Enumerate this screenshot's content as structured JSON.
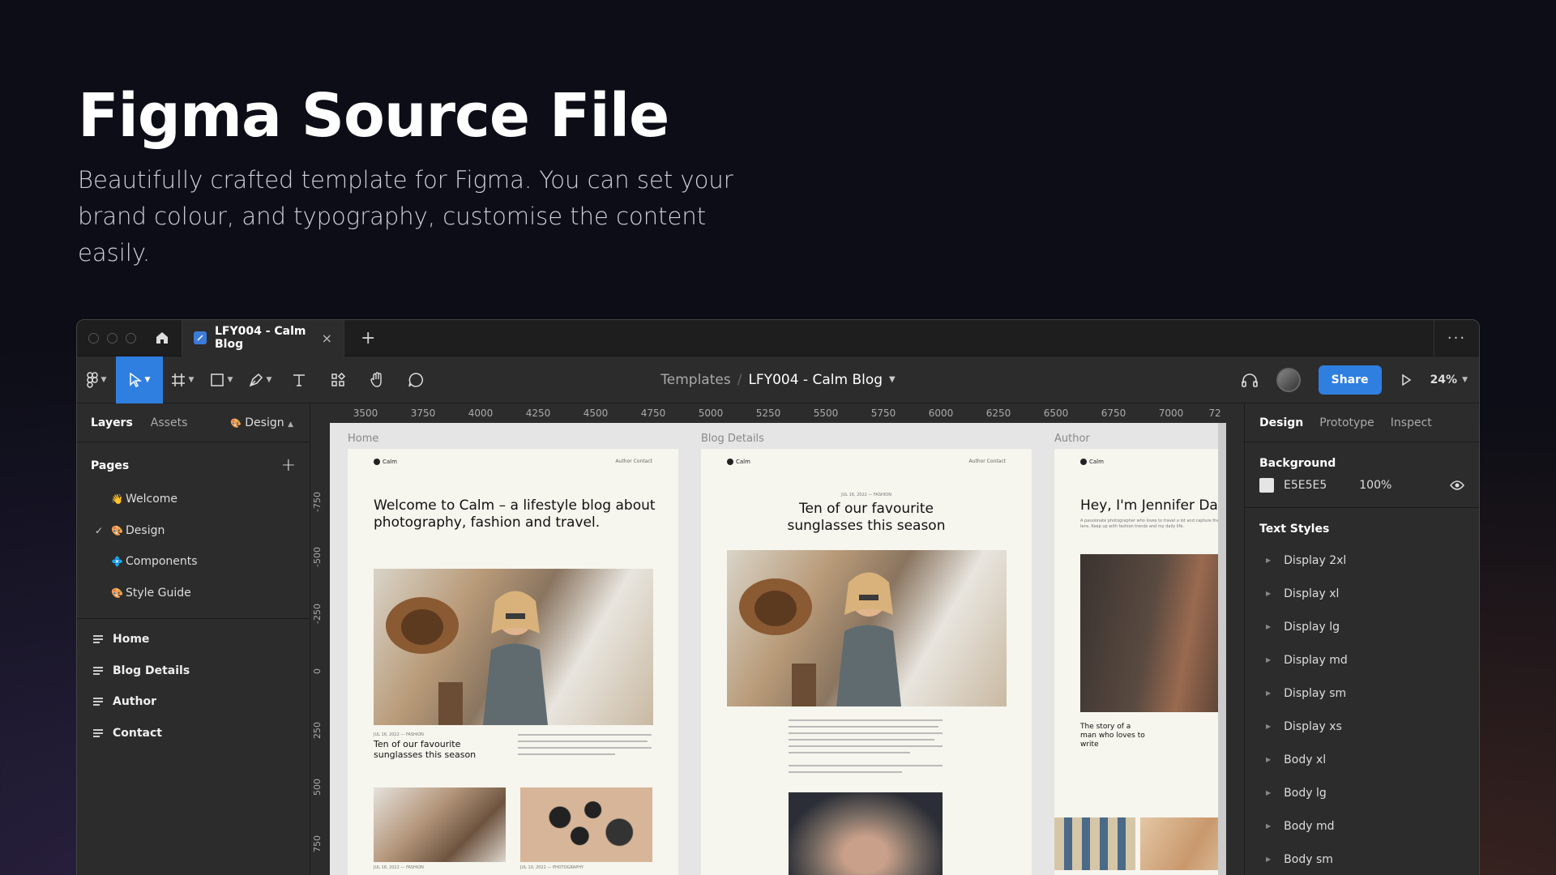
{
  "hero": {
    "title": "Figma Source File",
    "subtitle_line1": "Beautifully crafted template for Figma. You can set your",
    "subtitle_line2": "brand colour, and typography, customise the content easily."
  },
  "tabbar": {
    "file_tab": "LFY004 - Calm Blog",
    "close": "×",
    "add": "+",
    "more": "···"
  },
  "toolbar": {
    "breadcrumb_root": "Templates",
    "breadcrumb_sep": "/",
    "breadcrumb_file": "LFY004 - Calm Blog",
    "share": "Share",
    "zoom": "24%"
  },
  "left_panel": {
    "tab_layers": "Layers",
    "tab_assets": "Assets",
    "current_page": "Design",
    "pages_title": "Pages",
    "pages": [
      {
        "emoji": "👋",
        "label": "Welcome",
        "checked": false
      },
      {
        "emoji": "🎨",
        "label": "Design",
        "checked": true
      },
      {
        "emoji": "💠",
        "label": "Components",
        "checked": false
      },
      {
        "emoji": "🎨",
        "label": "Style Guide",
        "checked": false
      }
    ],
    "frames": [
      "Home",
      "Blog Details",
      "Author",
      "Contact"
    ]
  },
  "canvas": {
    "ruler_x": [
      "3500",
      "3750",
      "4000",
      "4250",
      "4500",
      "4750",
      "5000",
      "5250",
      "5500",
      "5750",
      "6000",
      "6250",
      "6500",
      "6750",
      "7000",
      "72"
    ],
    "ruler_y": [
      "-750",
      "-500",
      "-250",
      "0",
      "250",
      "500",
      "750"
    ],
    "frames": {
      "home": {
        "label": "Home",
        "logo": "Calm",
        "nav": "Author   Contact",
        "headline": "Welcome to Calm – a lifestyle blog about photography, fashion and travel.",
        "card_title": "Ten of our favourite sunglasses this season",
        "card_meta": "JUL 16, 2022 — FASHION",
        "meta2": "JUL 18, 2022 — FASHION",
        "meta3": "JUL 10, 2022 — PHOTOGRAPHY"
      },
      "blog": {
        "label": "Blog Details",
        "logo": "Calm",
        "nav": "Author   Contact",
        "meta": "JUL 16, 2022 — FASHION",
        "headline": "Ten of our favourite sunglasses this season"
      },
      "author": {
        "label": "Author",
        "logo": "Calm",
        "headline": "Hey, I'm Jennifer Davis",
        "intro": "A passionate photographer who loves to travel a lot and capture the world through my lens. Keep up with fashion trends and my daily life.",
        "story": "The story of a man who loves to write"
      }
    }
  },
  "right_panel": {
    "tab_design": "Design",
    "tab_prototype": "Prototype",
    "tab_inspect": "Inspect",
    "background_title": "Background",
    "background_hex": "E5E5E5",
    "background_opacity": "100%",
    "text_styles_title": "Text Styles",
    "text_styles": [
      "Display 2xl",
      "Display xl",
      "Display lg",
      "Display md",
      "Display sm",
      "Display xs",
      "Body xl",
      "Body lg",
      "Body md",
      "Body sm"
    ]
  },
  "colors": {
    "accent": "#2f7fe0",
    "panel": "#2c2c2c",
    "canvas": "#e5e5e5",
    "background": "#0c0d16"
  }
}
